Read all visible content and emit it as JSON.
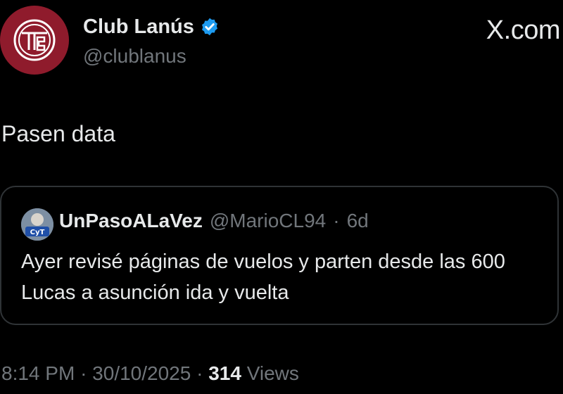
{
  "author": {
    "display_name": "Club Lanús",
    "handle": "@clublanus",
    "avatar_icon": "club-crest-icon",
    "verified_icon": "verified-badge-icon",
    "brand_color": "#8f1b2c"
  },
  "watermark": "X.com",
  "tweet": {
    "text": "Pasen data"
  },
  "quote": {
    "display_name": "UnPasoALaVez",
    "handle": "@MarioCL94",
    "separator": "·",
    "age": "6d",
    "text": "Ayer revisé páginas de vuelos y parten desde las 600 Lucas a asunción ida y vuelta"
  },
  "footer": {
    "time": "8:14 PM",
    "separator": "·",
    "date": "30/10/2025",
    "views_count": "314",
    "views_label": "Views"
  },
  "colors": {
    "background": "#000000",
    "text": "#e7e9ea",
    "muted": "#71767b",
    "verified": "#1d9bf0",
    "border": "#2f3336"
  }
}
